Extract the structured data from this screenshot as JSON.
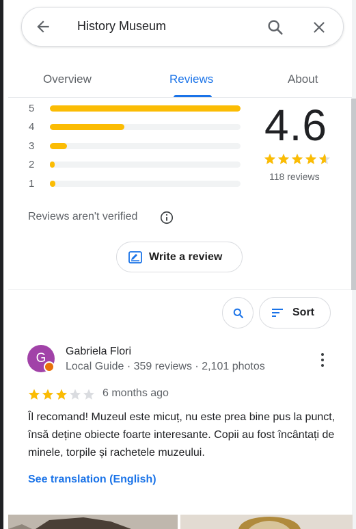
{
  "search": {
    "query": "History Museum",
    "back_icon": "arrow-back-icon",
    "search_icon": "search-icon",
    "close_icon": "close-icon"
  },
  "tabs": [
    {
      "label": "Overview",
      "active": false
    },
    {
      "label": "Reviews",
      "active": true
    },
    {
      "label": "About",
      "active": false
    }
  ],
  "rating_summary": {
    "average": "4.6",
    "stars": 4.6,
    "count_label": "118 reviews",
    "histogram": [
      {
        "label": "5",
        "fraction": 1.0
      },
      {
        "label": "4",
        "fraction": 0.39
      },
      {
        "label": "3",
        "fraction": 0.09
      },
      {
        "label": "2",
        "fraction": 0.02
      },
      {
        "label": "1",
        "fraction": 0.03
      }
    ]
  },
  "not_verified": {
    "text": "Reviews aren't verified",
    "icon": "info-icon"
  },
  "write_review": {
    "label": "Write a review",
    "icon": "write-review-icon"
  },
  "controls": {
    "search_icon": "search-icon",
    "sort_label": "Sort",
    "sort_icon": "sort-icon"
  },
  "review": {
    "avatar_letter": "G",
    "avatar_color": "#a142a8",
    "name": "Gabriela Flori",
    "meta": "Local Guide · 359 reviews · 2,101 photos",
    "stars": 3,
    "time": "6 months ago",
    "text": "Îl recomand! Muzeul este micuț, nu este prea bine pus la punct, însă deține obiecte foarte interesante. Copii au fost încântați de minele, torpile și rachetele muzeului.",
    "translate_label": "See translation (English)"
  },
  "colors": {
    "accent": "#1a73e8",
    "star": "#fbbc04",
    "star_empty": "#dadce0"
  }
}
